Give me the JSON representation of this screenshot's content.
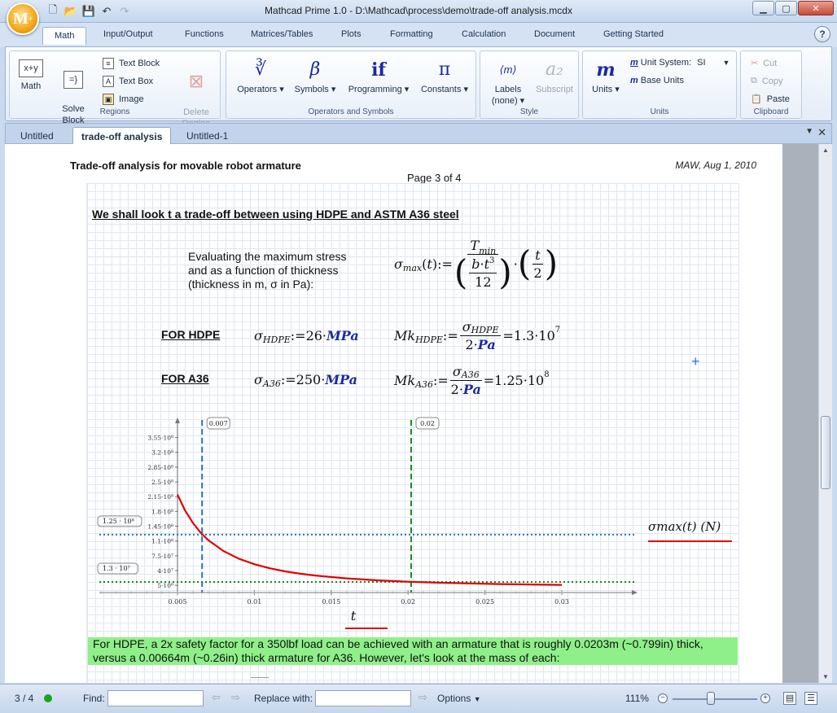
{
  "window": {
    "title": "Mathcad Prime 1.0 - D:\\Mathcad\\process\\demo\\trade-off analysis.mcdx",
    "logo": "M",
    "logo_sup": "+"
  },
  "ribbon_tabs": [
    "Math",
    "Input/Output",
    "Functions",
    "Matrices/Tables",
    "Plots",
    "Formatting",
    "Calculation",
    "Document",
    "Getting Started"
  ],
  "ribbon": {
    "regions": {
      "label": "Regions",
      "math": "Math",
      "solve_block": "Solve\nBlock",
      "text_block": "Text Block",
      "text_box": "Text Box",
      "image": "Image",
      "delete_region": "Delete\nRegion"
    },
    "operators": {
      "label": "Operators and Symbols",
      "operators": "Operators",
      "symbols": "Symbols",
      "programming": "Programming",
      "constants": "Constants"
    },
    "style": {
      "label": "Style",
      "labels": "Labels",
      "labels_value": "(none)",
      "subscript": "Subscript"
    },
    "units": {
      "label": "Units",
      "units": "Units",
      "unit_system": "Unit System:",
      "unit_system_value": "SI",
      "base_units": "Base Units"
    },
    "clipboard": {
      "label": "Clipboard",
      "cut": "Cut",
      "copy": "Copy",
      "paste": "Paste"
    }
  },
  "doc_tabs": [
    "Untitled",
    "trade-off analysis",
    "Untitled-1"
  ],
  "document": {
    "header_title": "Trade-off analysis for movable robot armature",
    "header_date": "MAW, Aug 1, 2010",
    "page_label": "Page 3 of 4",
    "heading": "We shall look t a trade-off between using HDPE and ASTM A36 steel",
    "eval_text": "Evaluating the maximum stress and as a function of thickness (thickness in m, σ in Pa):",
    "label_hdpe": "FOR HDPE",
    "label_a36": "FOR A36",
    "sigma_hdpe_value": "26",
    "sigma_a36_value": "250",
    "mk_hdpe_result": "1.3",
    "mk_hdpe_exp": "7",
    "mk_a36_result": "1.25",
    "mk_a36_exp": "8",
    "note": "For HDPE, a 2x safety factor for a 350lbf load can be achieved with an armature that is roughly 0.0203m (~0.799in) thick, versus a 0.00664m (~0.26in) thick armature for A36.  However, let's look at the mass of each:"
  },
  "chart_data": {
    "type": "line",
    "xlabel": "t",
    "ylabel": "σmax(t) (N)",
    "x_ticks": [
      "0.005",
      "0.01",
      "0.015",
      "0.02",
      "0.025",
      "0.03"
    ],
    "y_ticks": [
      "3.55·10⁸",
      "3.2·10⁸",
      "2.85·10⁸",
      "2.5·10⁸",
      "2.15·10⁸",
      "1.8·10⁸",
      "1.45·10⁸",
      "1.1·10⁸",
      "7.5·10⁷",
      "4·10⁷",
      "5·10⁶"
    ],
    "xlim": [
      0,
      0.0315
    ],
    "ylim": [
      -12000000.0,
      385000000.0
    ],
    "series": [
      {
        "name": "σmax(t)",
        "color": "#e00000",
        "x": [
          0.005,
          0.0055,
          0.006,
          0.0065,
          0.007,
          0.008,
          0.009,
          0.01,
          0.011,
          0.012,
          0.013,
          0.014,
          0.016,
          0.018,
          0.02,
          0.022,
          0.024,
          0.026,
          0.028,
          0.03
        ],
        "y": [
          220000000,
          182000000,
          153000000,
          130000000,
          112000000,
          86000000,
          68000000,
          55000000,
          45500000,
          38200000,
          32500000,
          28000000,
          21500000,
          17000000,
          13700000,
          11400000,
          9500000,
          8100000,
          7000000,
          6100000
        ]
      }
    ],
    "markers": [
      {
        "axis": "x",
        "value": 0.0066,
        "label": "0.007",
        "color": "#2a6fd1",
        "style": "dashed"
      },
      {
        "axis": "x",
        "value": 0.0202,
        "label": "0.02",
        "color": "#1a8a1a",
        "style": "dashed"
      },
      {
        "axis": "y",
        "value": 125000000,
        "label": "1.25 · 10⁸",
        "color": "#2a6fd1",
        "style": "dotted"
      },
      {
        "axis": "y",
        "value": 13000000,
        "label": "1.3 · 10⁷",
        "color": "#1a8a1a",
        "style": "dotted"
      }
    ]
  },
  "statusbar": {
    "page": "3 / 4",
    "find_label": "Find:",
    "replace_label": "Replace with:",
    "options": "Options",
    "zoom": "111%",
    "zoom_fraction": 0.45
  }
}
